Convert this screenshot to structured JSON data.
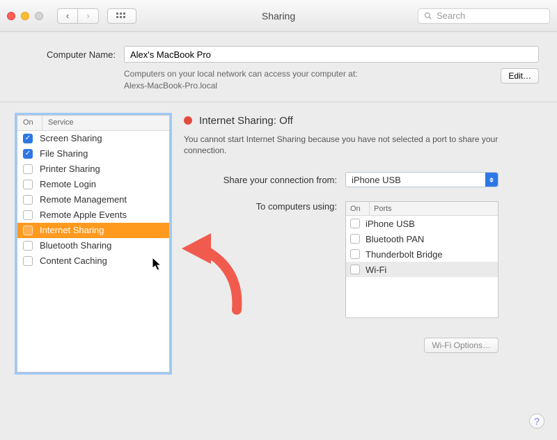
{
  "window": {
    "title": "Sharing",
    "search_placeholder": "Search"
  },
  "computer": {
    "label": "Computer Name:",
    "value": "Alex's MacBook Pro",
    "hint_line1": "Computers on your local network can access your computer at:",
    "hint_line2": "Alexs-MacBook-Pro.local",
    "edit_label": "Edit…"
  },
  "services": {
    "header_on": "On",
    "header_service": "Service",
    "items": [
      {
        "label": "Screen Sharing",
        "checked": true,
        "selected": false
      },
      {
        "label": "File Sharing",
        "checked": true,
        "selected": false
      },
      {
        "label": "Printer Sharing",
        "checked": false,
        "selected": false
      },
      {
        "label": "Remote Login",
        "checked": false,
        "selected": false
      },
      {
        "label": "Remote Management",
        "checked": false,
        "selected": false
      },
      {
        "label": "Remote Apple Events",
        "checked": false,
        "selected": false
      },
      {
        "label": "Internet Sharing",
        "checked": false,
        "selected": true
      },
      {
        "label": "Bluetooth Sharing",
        "checked": false,
        "selected": false
      },
      {
        "label": "Content Caching",
        "checked": false,
        "selected": false
      }
    ]
  },
  "detail": {
    "status_label": "Internet Sharing: Off",
    "status_dot_color": "#e24c3f",
    "status_desc": "You cannot start Internet Sharing because you have not selected a port to share your connection.",
    "share_from_label": "Share your connection from:",
    "share_from_value": "iPhone USB",
    "to_computers_label": "To computers using:",
    "ports_header_on": "On",
    "ports_header_ports": "Ports",
    "ports": [
      {
        "label": "iPhone USB",
        "checked": false,
        "highlight": false
      },
      {
        "label": "Bluetooth PAN",
        "checked": false,
        "highlight": false
      },
      {
        "label": "Thunderbolt Bridge",
        "checked": false,
        "highlight": false
      },
      {
        "label": "Wi-Fi",
        "checked": false,
        "highlight": true
      }
    ],
    "wifi_options_label": "Wi-Fi Options…"
  }
}
